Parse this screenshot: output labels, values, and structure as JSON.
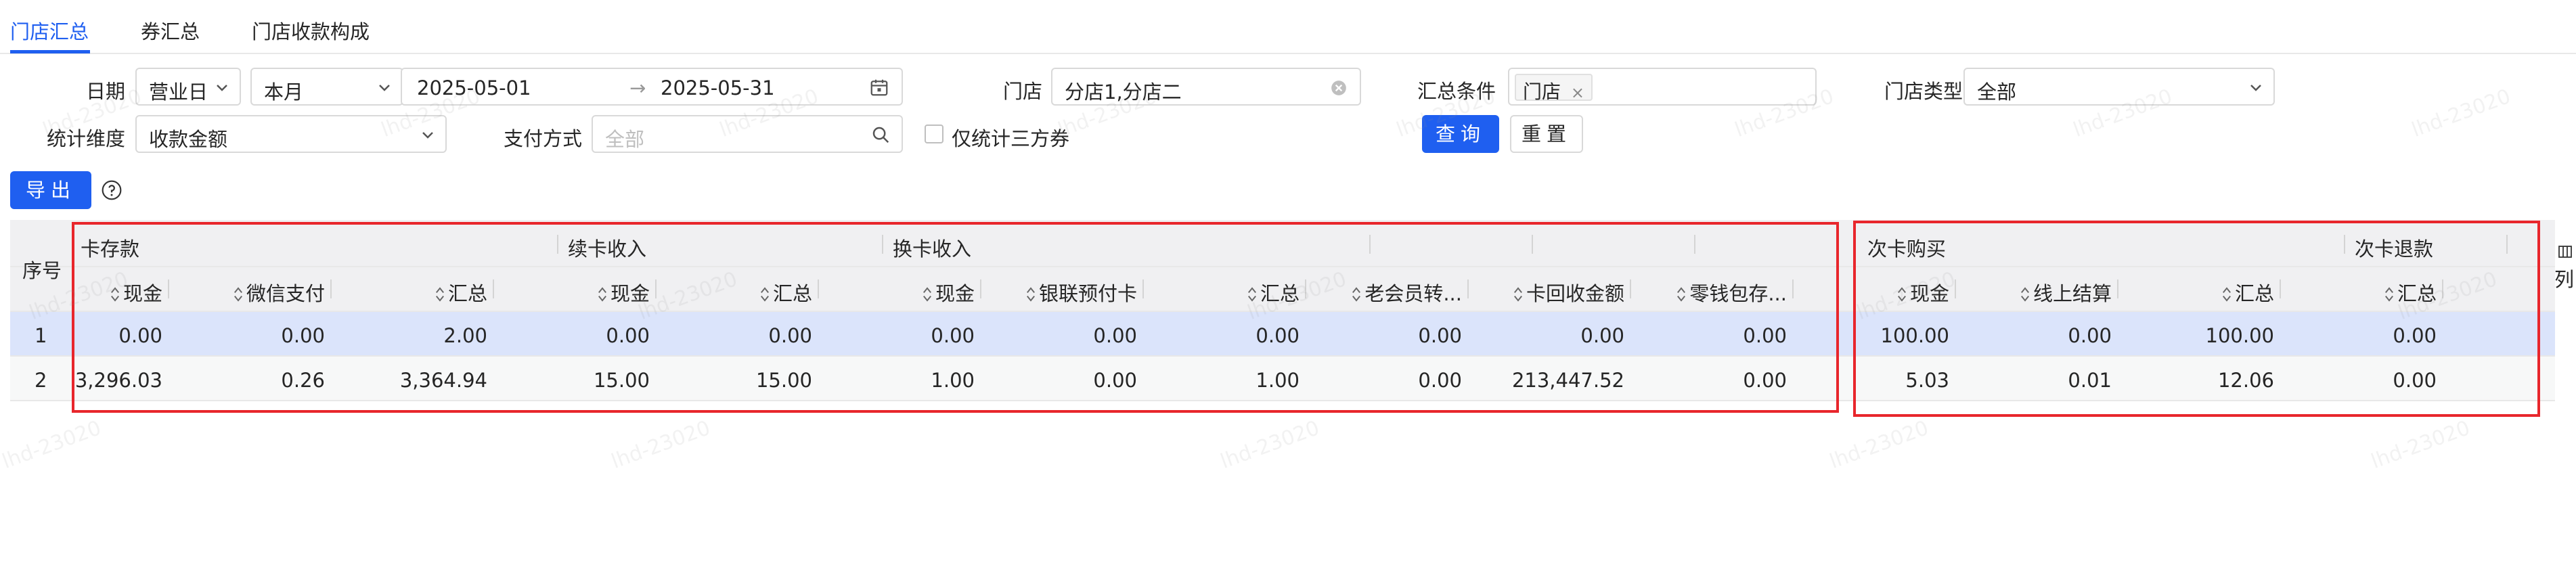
{
  "tabs": [
    {
      "label": "门店汇总",
      "active": true
    },
    {
      "label": "券汇总",
      "active": false
    },
    {
      "label": "门店收款构成",
      "active": false
    }
  ],
  "filters": {
    "date_label": "日期",
    "date_type": "营业日",
    "date_range_preset": "本月",
    "start_date": "2025-05-01",
    "range_arrow": "→",
    "end_date": "2025-05-31",
    "store_label": "门店",
    "store_value": "分店1,分店二",
    "summary_condition_label": "汇总条件",
    "summary_condition_tag": "门店",
    "store_type_label": "门店类型",
    "store_type_value": "全部",
    "stat_dimension_label": "统计维度",
    "stat_dimension_value": "收款金额",
    "payment_method_label": "支付方式",
    "payment_method_placeholder": "全部",
    "third_party_only_label": "仅统计三方券"
  },
  "buttons": {
    "query": "查询",
    "reset": "重置",
    "export": "导出",
    "columns": "列"
  },
  "table": {
    "index_header": "序号",
    "groups": [
      {
        "label": "卡存款"
      },
      {
        "label": "续卡收入"
      },
      {
        "label": "换卡收入"
      },
      {
        "label": "次卡购买"
      },
      {
        "label": "次卡退款"
      }
    ],
    "columns": [
      "现金",
      "微信支付",
      "汇总",
      "现金",
      "汇总",
      "现金",
      "银联预付卡",
      "汇总",
      "老会员转...",
      "卡回收金额",
      "零钱包存...",
      "现金",
      "线上结算",
      "汇总",
      "汇总"
    ],
    "rows": [
      {
        "index": "1",
        "cells": [
          "0.00",
          "0.00",
          "2.00",
          "0.00",
          "0.00",
          "0.00",
          "0.00",
          "0.00",
          "0.00",
          "0.00",
          "0.00",
          "100.00",
          "0.00",
          "100.00",
          "0.00"
        ]
      },
      {
        "index": "2",
        "cells": [
          "3,296.03",
          "0.26",
          "3,364.94",
          "15.00",
          "15.00",
          "1.00",
          "0.00",
          "1.00",
          "0.00",
          "213,447.52",
          "0.00",
          "5.03",
          "0.01",
          "12.06",
          "0.00"
        ]
      }
    ]
  },
  "watermark_text": "lhd-23020",
  "colors": {
    "accent": "#1f5ff0",
    "highlight_box": "#e8262c",
    "selected_row": "#dbe4fb"
  }
}
